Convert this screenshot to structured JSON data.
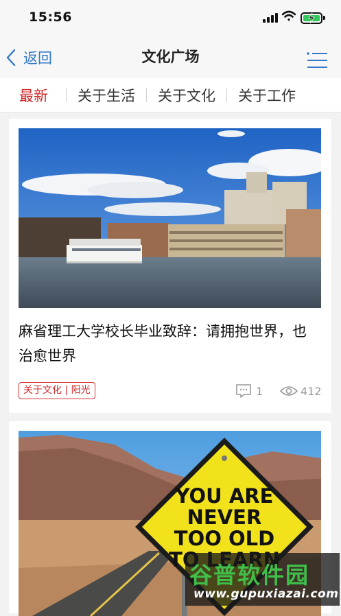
{
  "status_bar": {
    "time": "15:56",
    "icons": [
      "signal-icon",
      "wifi-icon",
      "battery-charging-icon"
    ],
    "battery_color": "#34c759"
  },
  "nav": {
    "back_label": "返回",
    "title": "文化广场",
    "accent_color": "#3478c8"
  },
  "tabs": [
    {
      "label": "最新",
      "active": true
    },
    {
      "label": "关于生活",
      "active": false
    },
    {
      "label": "关于文化",
      "active": false
    },
    {
      "label": "关于工作",
      "active": false
    }
  ],
  "active_tab_color": "#d22a2a",
  "articles": [
    {
      "image": "river-boat-campus-photo",
      "title": "麻省理工大学校长毕业致辞：请拥抱世界，也治愈世界",
      "tag": "关于文化 | 阳光",
      "comments": "1",
      "views": "412"
    },
    {
      "image": "road-sign-desert-photo",
      "sign_text": "YOU ARE NEVER TOO OLD TO LEARN"
    }
  ],
  "watermark": {
    "main": "谷普软件园",
    "url": "www.gupuxiazai.com"
  }
}
